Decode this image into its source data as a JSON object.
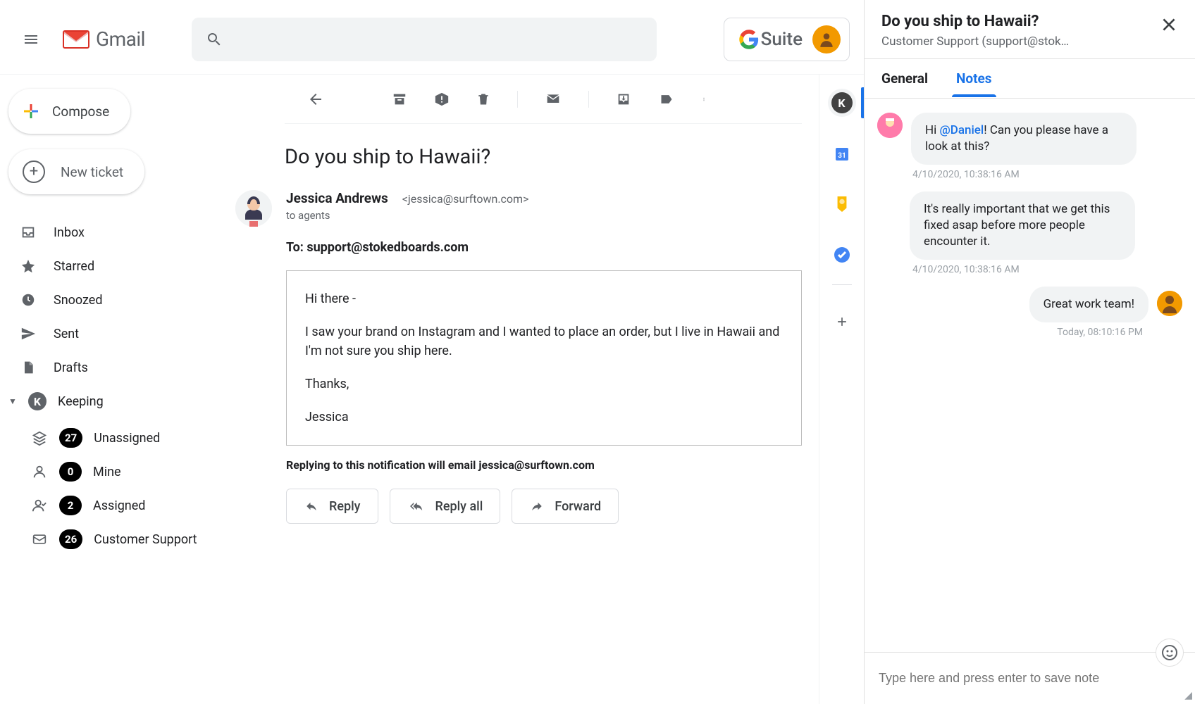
{
  "header": {
    "brand": "Gmail",
    "gsuite": "Suite"
  },
  "sidebar": {
    "compose": "Compose",
    "new_ticket": "New ticket",
    "items": [
      {
        "label": "Inbox"
      },
      {
        "label": "Starred"
      },
      {
        "label": "Snoozed"
      },
      {
        "label": "Sent"
      },
      {
        "label": "Drafts"
      }
    ],
    "keeping": {
      "label": "Keeping"
    },
    "sub": [
      {
        "label": "Unassigned",
        "count": "27"
      },
      {
        "label": "Mine",
        "count": "0"
      },
      {
        "label": "Assigned",
        "count": "2"
      },
      {
        "label": "Customer Support",
        "count": "26"
      }
    ]
  },
  "email": {
    "subject": "Do you ship to Hawaii?",
    "sender_name": "Jessica Andrews",
    "sender_email": "<jessica@surftown.com>",
    "sender_to": "to agents",
    "to_line": "To: support@stokedboards.com",
    "body": {
      "p1": "Hi there -",
      "p2": "I saw your brand on Instagram and I wanted to place an order, but I live in Hawaii and I'm not sure you ship here.",
      "p3": "Thanks,",
      "p4": "Jessica"
    },
    "reply_notice": "Replying to this notification will email jessica@surftown.com",
    "actions": {
      "reply": "Reply",
      "reply_all": "Reply all",
      "forward": "Forward"
    }
  },
  "panel": {
    "title": "Do you ship to Hawaii?",
    "subtitle": "Customer Support (support@stok…",
    "tabs": {
      "general": "General",
      "notes": "Notes"
    },
    "notes": [
      {
        "text_pre": "Hi ",
        "mention": "@Daniel",
        "text_post": "! Can you please have a look at this?",
        "time": "4/10/2020, 10:38:16 AM",
        "side": "left"
      },
      {
        "text": "It's really important that we get this fixed asap before more people encounter it.",
        "time": "4/10/2020, 10:38:16 AM",
        "side": "left-noavatar"
      },
      {
        "text": "Great work team!",
        "time": "Today, 08:10:16 PM",
        "side": "right"
      }
    ],
    "input_placeholder": "Type here and press enter to save note"
  }
}
